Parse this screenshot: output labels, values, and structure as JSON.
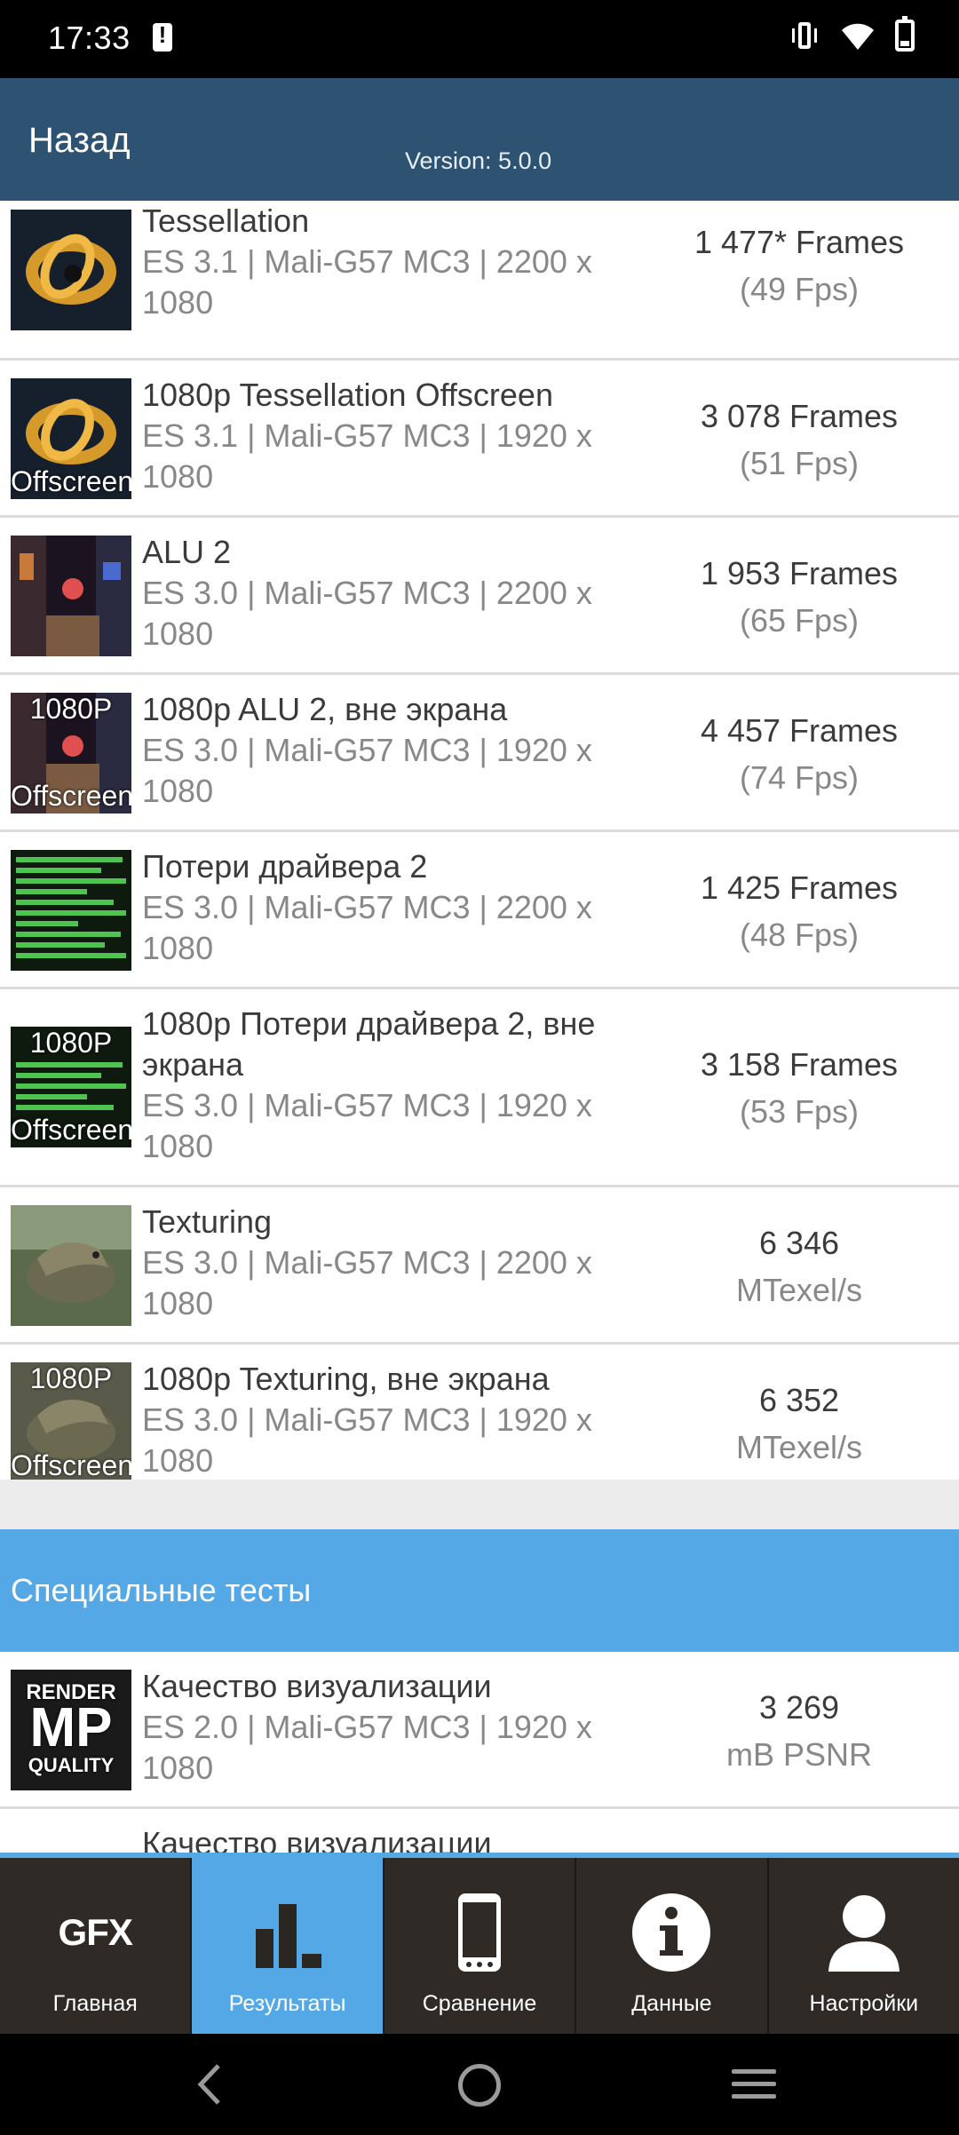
{
  "status_bar": {
    "time": "17:33"
  },
  "header": {
    "back_label": "Назад",
    "version": "Version: 5.0.0"
  },
  "rows": [
    {
      "title": "Tessellation",
      "subtitle": "ES 3.1 | Mali-G57 MC3 | 2200 x 1080",
      "value": "1 477* Frames",
      "unit": "(49 Fps)",
      "thumb": "tessellation"
    },
    {
      "title": "1080p Tessellation Offscreen",
      "subtitle": "ES 3.1 | Mali-G57 MC3 | 1920 x 1080",
      "value": "3 078 Frames",
      "unit": "(51 Fps)",
      "thumb": "tessellation",
      "thumb_bottom": "Offscreen"
    },
    {
      "title": "ALU 2",
      "subtitle": "ES 3.0 | Mali-G57 MC3 | 2200 x 1080",
      "value": "1 953 Frames",
      "unit": "(65 Fps)",
      "thumb": "alu"
    },
    {
      "title": "1080p ALU 2, вне экрана",
      "subtitle": "ES 3.0 | Mali-G57 MC3 | 1920 x 1080",
      "value": "4 457 Frames",
      "unit": "(74 Fps)",
      "thumb": "alu",
      "thumb_top": "1080P",
      "thumb_bottom": "Offscreen"
    },
    {
      "title": "Потери драйвера 2",
      "subtitle": "ES 3.0 | Mali-G57 MC3 | 2200 x 1080",
      "value": "1 425 Frames",
      "unit": "(48 Fps)",
      "thumb": "driver"
    },
    {
      "title": "1080p Потери драйвера 2, вне экрана",
      "subtitle": "ES 3.0 | Mali-G57 MC3 | 1920 x 1080",
      "value": "3 158 Frames",
      "unit": "(53 Fps)",
      "thumb": "driver",
      "thumb_top": "1080P",
      "thumb_bottom": "Offscreen"
    },
    {
      "title": "Texturing",
      "subtitle": "ES 3.0 | Mali-G57 MC3 | 2200 x 1080",
      "value": "6 346",
      "unit": "MTexel/s",
      "thumb": "texturing"
    },
    {
      "title": "1080p Texturing, вне экрана",
      "subtitle": "ES 3.0 | Mali-G57 MC3 | 1920 x 1080",
      "value": "6 352",
      "unit": "MTexel/s",
      "thumb": "texturing",
      "thumb_top": "1080P",
      "thumb_bottom": "Offscreen"
    }
  ],
  "special_section": {
    "title": "Специальные тесты",
    "rows": [
      {
        "title": "Качество визуализации",
        "subtitle": "ES 2.0 | Mali-G57 MC3 | 1920 x 1080",
        "value": "3 269",
        "unit": "mB PSNR",
        "thumb": "render",
        "thumb_top": "RENDER",
        "thumb_mid": "MP",
        "thumb_bottom": "QUALITY"
      },
      {
        "title": "Качество визуализации",
        "subtitle": "",
        "value": "",
        "unit": ""
      }
    ]
  },
  "tabs": [
    {
      "label": "Главная",
      "icon": "gfx-logo-icon",
      "icon_text": "GFX",
      "active": false
    },
    {
      "label": "Результаты",
      "icon": "bar-chart-icon",
      "active": true
    },
    {
      "label": "Сравнение",
      "icon": "phone-icon",
      "active": false
    },
    {
      "label": "Данные",
      "icon": "info-icon",
      "active": false
    },
    {
      "label": "Настройки",
      "icon": "user-icon",
      "active": false
    }
  ],
  "colors": {
    "header": "#2d5272",
    "accent": "#55a8e6",
    "tabbar": "#2f2a25"
  }
}
